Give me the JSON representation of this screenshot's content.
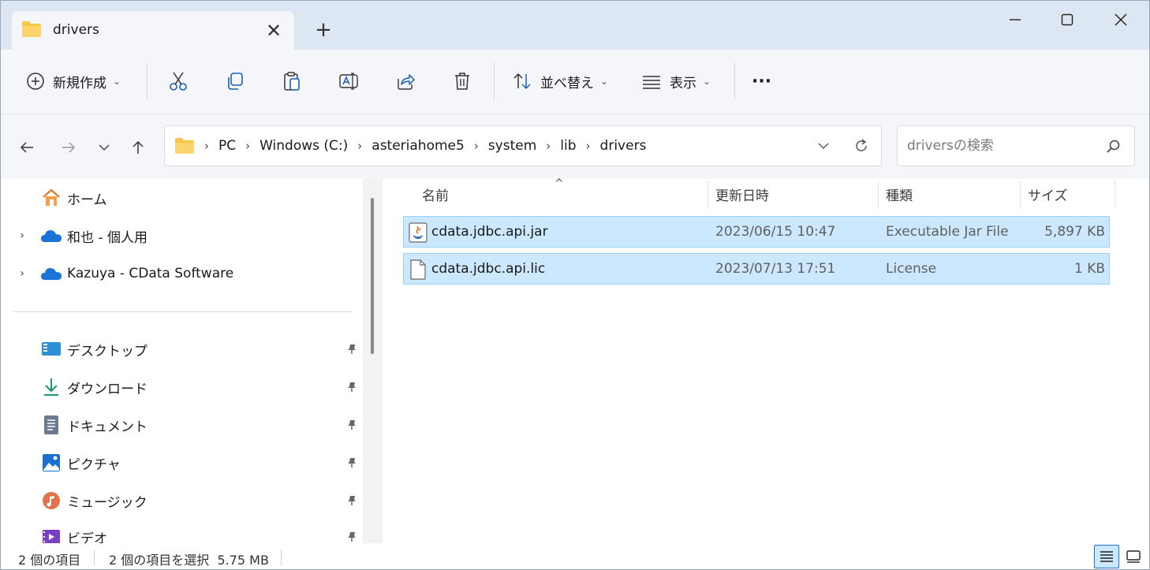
{
  "tab": {
    "title": "drivers",
    "close_glyph": "✕",
    "new_tab_glyph": "+"
  },
  "window_controls": {
    "minimize": "minimize-icon",
    "maximize": "maximize-icon",
    "close": "close-icon"
  },
  "toolbar": {
    "new_label": "新規作成",
    "sort_label": "並べ替え",
    "view_label": "表示",
    "more_label": "···",
    "icons": [
      "plus-circle-icon",
      "cut-icon",
      "copy-icon",
      "paste-icon",
      "rename-icon",
      "share-icon",
      "delete-icon",
      "sort-icon",
      "view-icon",
      "more-icon"
    ]
  },
  "address": {
    "crumbs": [
      "PC",
      "Windows (C:)",
      "asteriahome5",
      "system",
      "lib",
      "drivers"
    ],
    "separator": "›"
  },
  "search": {
    "placeholder": "driversの検索"
  },
  "sidebar": {
    "top_items": [
      {
        "label": "ホーム",
        "icon": "home-icon"
      },
      {
        "label": "和也 - 個人用",
        "icon": "onedrive-icon"
      },
      {
        "label": "Kazuya - CData Software",
        "icon": "onedrive-icon"
      }
    ],
    "quick_items": [
      {
        "label": "デスクトップ",
        "icon": "desktop-icon"
      },
      {
        "label": "ダウンロード",
        "icon": "download-icon"
      },
      {
        "label": "ドキュメント",
        "icon": "documents-icon"
      },
      {
        "label": "ピクチャ",
        "icon": "pictures-icon"
      },
      {
        "label": "ミュージック",
        "icon": "music-icon"
      },
      {
        "label": "ビデオ",
        "icon": "videos-icon"
      }
    ]
  },
  "columns": {
    "name": "名前",
    "date": "更新日時",
    "type": "種類",
    "size": "サイズ"
  },
  "files": [
    {
      "name": "cdata.jdbc.api.jar",
      "date": "2023/06/15 10:47",
      "type": "Executable Jar File",
      "size": "5,897 KB",
      "icon": "jar-file-icon",
      "selected": true
    },
    {
      "name": "cdata.jdbc.api.lic",
      "date": "2023/07/13 17:51",
      "type": "License",
      "size": "1 KB",
      "icon": "file-icon",
      "selected": true
    }
  ],
  "status": {
    "item_count": "2 個の項目",
    "selection": "2 個の項目を選択  5.75 MB"
  },
  "colors": {
    "accent": "#1a73d6",
    "selection": "#cce8ff",
    "selection_border": "#99d1ff",
    "chrome": "#f4f6fa",
    "titlebar": "#dde6f3",
    "folder": "#f8c64a"
  }
}
